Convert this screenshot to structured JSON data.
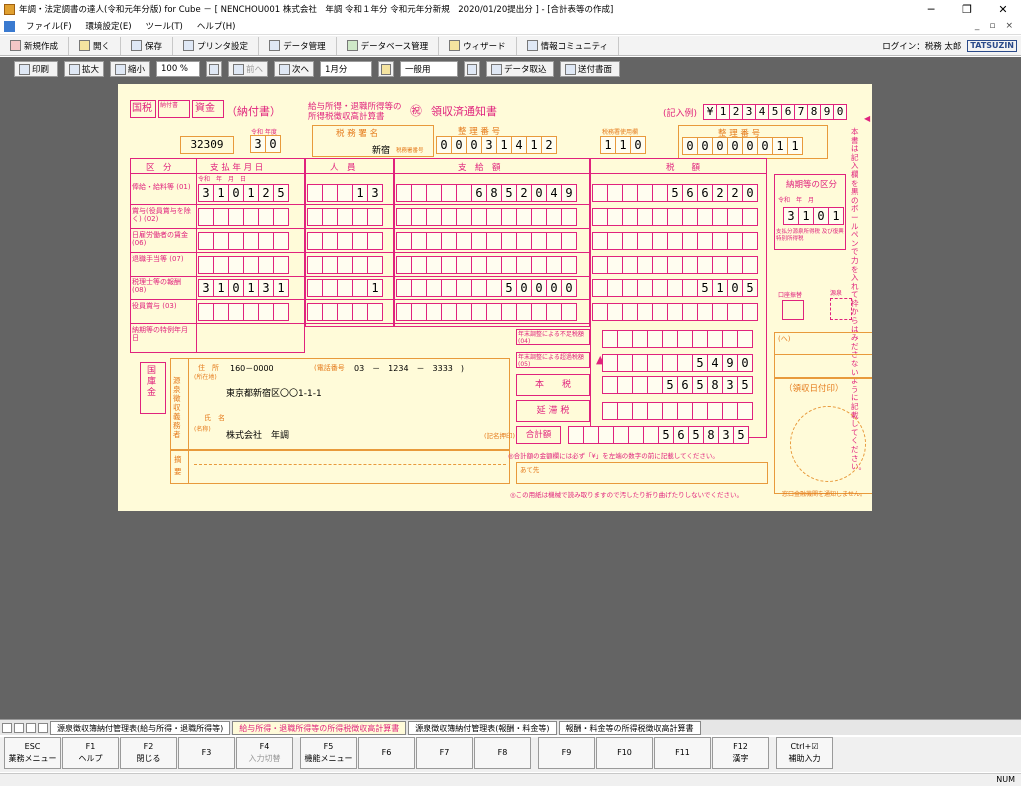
{
  "window": {
    "title": "年調・法定調書の達人(令和元年分版) for Cube － [ NENCHOU001 株式会社　年調 令和１年分 令和元年分新規　2020/01/20提出分 ] - [合計表等の作成]",
    "min": "─",
    "max": "❐",
    "close": "✕"
  },
  "menu": {
    "items": [
      "ファイル(F)",
      "環境設定(E)",
      "ツール(T)",
      "ヘルプ(H)"
    ],
    "right": [
      "_",
      "▫",
      "×"
    ]
  },
  "toolbar1": {
    "items": [
      "新規作成",
      "開く",
      "保存",
      "プリンタ設定",
      "データ管理",
      "データベース管理",
      "ウィザード",
      "情報コミュニティ"
    ],
    "login": "ログイン：税務 太郎",
    "brand": "TATSUZIN"
  },
  "toolbar2": {
    "print": "印刷",
    "zoom_in": "拡大",
    "zoom_out": "縮小",
    "zoom_value": "100 %",
    "prev": "前へ",
    "next": "次へ",
    "month": "1月分",
    "mode": "一般用",
    "data_fetch": "データ取込",
    "send": "送付書面"
  },
  "form": {
    "kokuzei": "国税",
    "kaisou": "納付書",
    "shikin": "資金",
    "nofusho": "（納付書）",
    "head_title_1": "給与所得・退職所得等の",
    "head_title_2": "所得税徴収高計算書",
    "ryoshu_mark": "㊗",
    "ryoshu": "領収済通知書",
    "kinyurei": "(記入例)",
    "kinyurei_digits": [
      "¥",
      "1",
      "2",
      "3",
      "4",
      "5",
      "6",
      "7",
      "8",
      "9",
      "0"
    ],
    "code": "32309",
    "nendo_label": "令和 年度",
    "nendo": [
      "3",
      "0"
    ],
    "zeimusho_label": "税 務 署 名",
    "zeimusho": "新宿",
    "zeimusho_no_label": "税務署番号",
    "seiri_label": "整 理 番 号",
    "seiri": [
      "0",
      "0",
      "0",
      "3",
      "1",
      "4",
      "1",
      "2"
    ],
    "jigyo_label": "税務署使用欄",
    "jigyo": [
      "1",
      "1",
      "0"
    ],
    "shokuban_label": "整 理 番 号",
    "shokuban": [
      "0",
      "0",
      "0",
      "0",
      "0",
      "0",
      "1",
      "1"
    ],
    "side_note": "本書は記入欄を黒のボールペンで力を入れて枠からはみださないように記載してください。",
    "col_kubun": "区　分",
    "col_shiharai": "支 払 年 月 日",
    "col_jinin": "人　員",
    "col_shikyu": "支　給　額",
    "col_zeigaku": "税　　額",
    "ym_labels": "令和　年　月　日",
    "rows": [
      {
        "label": "俸給・給料等",
        "code": "(01)",
        "ymd": [
          "3",
          "1",
          "0",
          "1",
          "2",
          "5"
        ],
        "jinin": [
          "1",
          "3"
        ],
        "shikyu": [
          "6",
          "8",
          "5",
          "2",
          "0",
          "4",
          "9"
        ],
        "zei": [
          "5",
          "6",
          "6",
          "2",
          "2",
          "0"
        ]
      },
      {
        "label": "賞与(役員賞与を除く)",
        "code": "(02)",
        "ymd": [],
        "jinin": [],
        "shikyu": [],
        "zei": []
      },
      {
        "label": "日雇労働者の賃金",
        "code": "(06)",
        "ymd": [],
        "jinin": [],
        "shikyu": [],
        "zei": []
      },
      {
        "label": "退職手当等",
        "code": "(07)",
        "ymd": [],
        "jinin": [],
        "shikyu": [],
        "zei": []
      },
      {
        "label": "税理士等の報酬",
        "code": "(08)",
        "ymd": [
          "3",
          "1",
          "0",
          "1",
          "3",
          "1"
        ],
        "jinin": [
          "1"
        ],
        "shikyu": [
          "5",
          "0",
          "0",
          "0",
          "0"
        ],
        "zei": [
          "5",
          "1",
          "0",
          "5"
        ]
      },
      {
        "label": "役員賞与",
        "code": "(03)",
        "ymd": [],
        "jinin": [],
        "shikyu": [],
        "zei": []
      },
      {
        "label": "納期等の特例年月日",
        "code": "",
        "ymd": [],
        "jinin": [],
        "shikyu": [],
        "zei": []
      }
    ],
    "noki_label": "納期等の区分",
    "noki_sub": "令和　年　月",
    "noki": [
      "3",
      "1",
      "0",
      "1"
    ],
    "noki_note": "支払分源泉所得税 及び復興特別所得税",
    "tokurei_label": "延滞税",
    "tokurei_mark": "(へ)",
    "nenchou_fuso": "年末調整による不足税額",
    "nenchou_fuso_code": "(04)",
    "nenchou_chokin": "年末調整による超過税額",
    "nenchou_chokin_code": "(05)",
    "chokin_mark": "▲",
    "chokin": [
      "5",
      "4",
      "9",
      "0"
    ],
    "honzei": "本　　税",
    "honzei_val": [
      "5",
      "6",
      "5",
      "8",
      "3",
      "5"
    ],
    "entaizei": "延 滞 税",
    "gokei": "合計額",
    "gokei_val": [
      "5",
      "6",
      "5",
      "8",
      "3",
      "5"
    ],
    "gokei_note": "◎合計額の金額欄には必ず「¥」を左端の数字の前に記載してください。",
    "kokko": "国庫金",
    "addr_label": "住　所",
    "addr_sub": "(所在地)",
    "zip": "160－0000",
    "tel_label": "(電話番号",
    "tel": "03　－　1234　－　3333　)",
    "addr": "東京都新宿区〇〇1-1-1",
    "name_label": "氏　名",
    "name_sub": "(名称)",
    "name": "株式会社　年調",
    "stamp_note": "(記名押印)",
    "shiharai_label": "源泉徴収義務者",
    "tekiyo": "摘要",
    "ate": "あて先",
    "ryoshu_stamp": "（領収日付印）",
    "hinichi_label": "日銀",
    "nichigin": "円",
    "yen_label": "円",
    "footer_note": "◎この用紙は機械で読み取りますので汚したり折り曲げたりしないでください。",
    "footer_note2": "窓口金融機関を通知しません。",
    "shoruimark_1": "口座振替",
    "shoruimark_2": "源泉"
  },
  "sheet_tabs": [
    "源泉徴収簿納付管理表(給与所得・退職所得等)",
    "給与所得・退職所得等の所得税徴収高計算書",
    "源泉徴収簿納付管理表(報酬・料金等)",
    "報酬・料金等の所得税徴収高計算書"
  ],
  "active_tab": 1,
  "fkeys": [
    {
      "key": "ESC",
      "label": "業務メニュー",
      "dis": false
    },
    {
      "key": "F1",
      "label": "ヘルプ",
      "dis": false
    },
    {
      "key": "F2",
      "label": "閉じる",
      "dis": false
    },
    {
      "key": "F3",
      "label": "",
      "dis": false
    },
    {
      "key": "F4",
      "label": "入力切替",
      "dis": true
    },
    {
      "key": "F5",
      "label": "機能メニュー",
      "dis": false
    },
    {
      "key": "F6",
      "label": "",
      "dis": false
    },
    {
      "key": "F7",
      "label": "",
      "dis": false
    },
    {
      "key": "F8",
      "label": "",
      "dis": false
    },
    {
      "key": "F9",
      "label": "",
      "dis": false
    },
    {
      "key": "F10",
      "label": "",
      "dis": false
    },
    {
      "key": "F11",
      "label": "",
      "dis": false
    },
    {
      "key": "F12",
      "label": "漢字",
      "dis": false
    },
    {
      "key": "Ctrl+☑",
      "label": "補助入力",
      "dis": false
    }
  ],
  "status": {
    "num": "NUM"
  }
}
